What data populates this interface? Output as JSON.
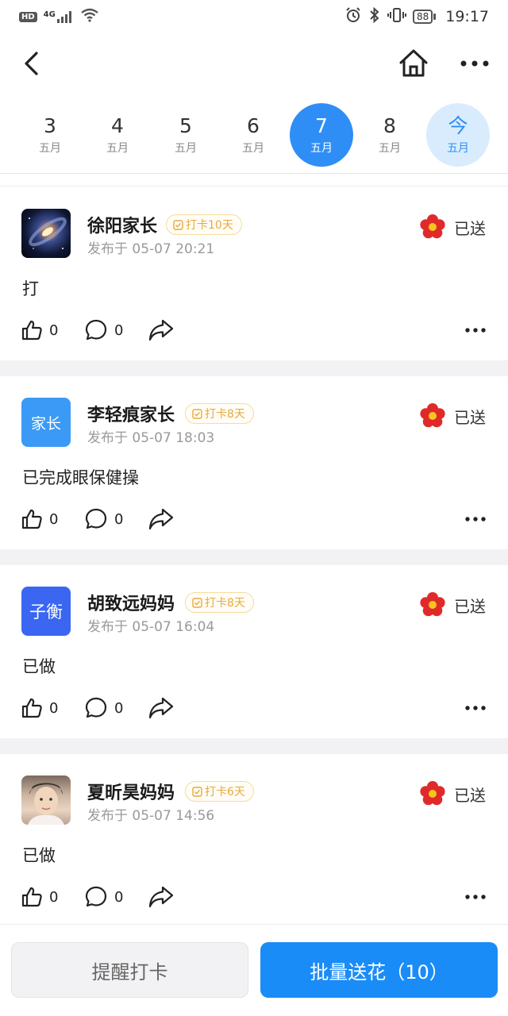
{
  "status_bar": {
    "hd": "HD",
    "network": "4G",
    "battery": "88",
    "time": "19:17"
  },
  "nav": {
    "back_icon": "chevron-left-icon",
    "home_icon": "home-icon",
    "more_icon": "more-horizontal-icon"
  },
  "dates": [
    {
      "day": "3",
      "month": "五月"
    },
    {
      "day": "4",
      "month": "五月"
    },
    {
      "day": "5",
      "month": "五月"
    },
    {
      "day": "6",
      "month": "五月"
    },
    {
      "day": "7",
      "month": "五月"
    },
    {
      "day": "8",
      "month": "五月"
    },
    {
      "day": "今",
      "month": "五月"
    }
  ],
  "colors": {
    "accent": "#2f8ef5",
    "today_bg": "#d9ecfd",
    "badge_text": "#e8a93a",
    "flower": "#e02a2a"
  },
  "posts": [
    {
      "avatar_type": "galaxy-image",
      "avatar_text": "",
      "name": "徐阳家长",
      "streak": "打卡10天",
      "time": "发布于 05-07 20:21",
      "sent": "已送",
      "content": "打",
      "likes": "0",
      "comments": "0"
    },
    {
      "avatar_type": "text",
      "avatar_text": "家长",
      "avatar_color": "#3a9af6",
      "name": "李轻痕家长",
      "streak": "打卡8天",
      "time": "发布于 05-07 18:03",
      "sent": "已送",
      "content": "已完成眼保健操",
      "likes": "0",
      "comments": "0"
    },
    {
      "avatar_type": "text",
      "avatar_text": "子衡",
      "avatar_color": "#3a66f2",
      "name": "胡致远妈妈",
      "streak": "打卡8天",
      "time": "发布于 05-07 16:04",
      "sent": "已送",
      "content": "已做",
      "likes": "0",
      "comments": "0"
    },
    {
      "avatar_type": "portrait-photo",
      "avatar_text": "",
      "name": "夏昕昊妈妈",
      "streak": "打卡6天",
      "time": "发布于 05-07 14:56",
      "sent": "已送",
      "content": "已做",
      "likes": "0",
      "comments": "0"
    }
  ],
  "bottom": {
    "remind_label": "提醒打卡",
    "batch_label": "批量送花（10）"
  }
}
